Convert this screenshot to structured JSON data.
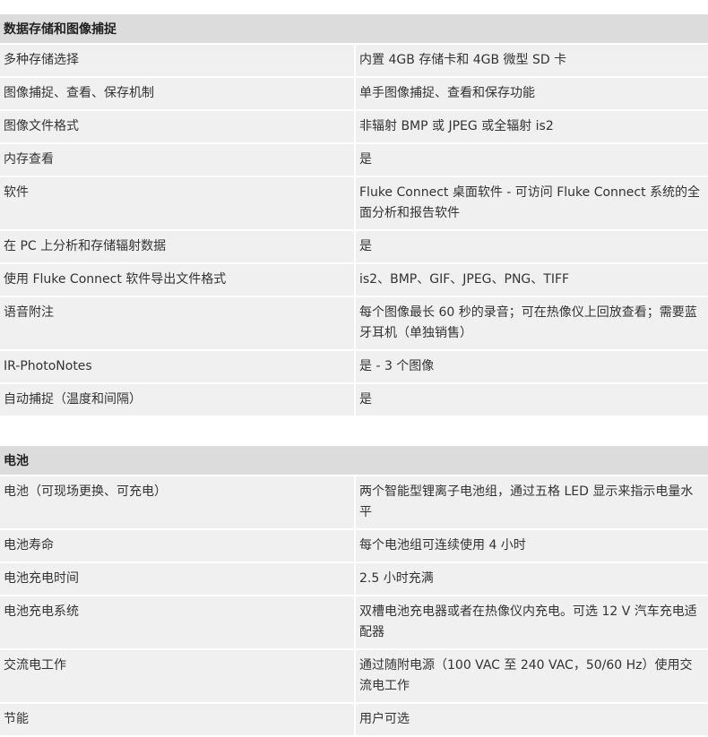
{
  "sections": [
    {
      "title": "数据存储和图像捕捉",
      "rows": [
        {
          "label": "多种存储选择",
          "value": "内置 4GB 存储卡和 4GB 微型 SD 卡"
        },
        {
          "label": "图像捕捉、查看、保存机制",
          "value": "单手图像捕捉、查看和保存功能"
        },
        {
          "label": "图像文件格式",
          "value": "非辐射 BMP 或 JPEG 或全辐射 is2"
        },
        {
          "label": "内存查看",
          "value": "是"
        },
        {
          "label": "软件",
          "value": "Fluke Connect 桌面软件 - 可访问 Fluke Connect 系统的全面分析和报告软件"
        },
        {
          "label": "在 PC 上分析和存储辐射数据",
          "value": "是"
        },
        {
          "label": "使用 Fluke Connect 软件导出文件格式",
          "value": "is2、BMP、GIF、JPEG、PNG、TIFF"
        },
        {
          "label": "语音附注",
          "value": "每个图像最长 60 秒的录音；可在热像仪上回放查看；需要蓝牙耳机（单独销售）"
        },
        {
          "label": "IR-PhotoNotes",
          "value": "是 - 3 个图像"
        },
        {
          "label": "自动捕捉（温度和间隔）",
          "value": "是"
        }
      ]
    },
    {
      "title": "电池",
      "rows": [
        {
          "label": "电池（可现场更换、可充电）",
          "value": "两个智能型锂离子电池组，通过五格 LED 显示来指示电量水平"
        },
        {
          "label": "电池寿命",
          "value": "每个电池组可连续使用 4 小时"
        },
        {
          "label": "电池充电时间",
          "value": "2.5 小时充满"
        },
        {
          "label": "电池充电系统",
          "value": "双槽电池充电器或者在热像仪内充电。可选 12 V 汽车充电适配器"
        },
        {
          "label": "交流电工作",
          "value": "通过随附电源（100 VAC 至 240 VAC，50/60 Hz）使用交流电工作"
        },
        {
          "label": "节能",
          "value": "用户可选"
        }
      ]
    }
  ]
}
